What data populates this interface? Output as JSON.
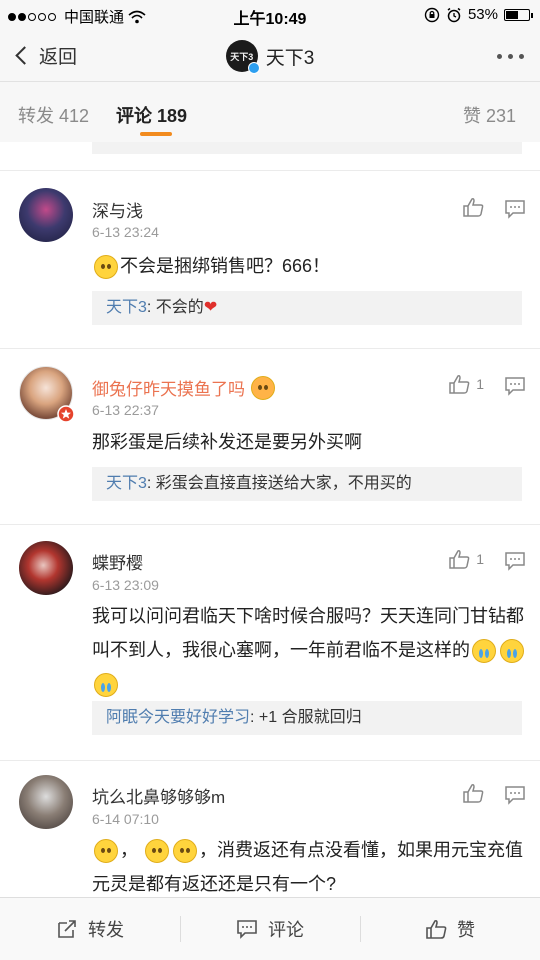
{
  "status_bar": {
    "carrier": "中国联通",
    "time": "上午10:49",
    "battery": "53%",
    "battery_level": 0.53,
    "icons": [
      "signal-dots-icon",
      "wifi-icon",
      "orientation-lock-icon",
      "alarm-icon",
      "battery-icon"
    ]
  },
  "nav": {
    "back_label": "返回",
    "title": "天下3",
    "logo_text": "天下3",
    "icons": [
      "chevron-left-icon",
      "verified-badge-icon",
      "more-icon"
    ]
  },
  "tabs": [
    {
      "label": "转发",
      "count": "412"
    },
    {
      "label": "评论",
      "count": "189"
    },
    {
      "label": "赞",
      "count": "231"
    }
  ],
  "comments": [
    {
      "author": "深与浅",
      "time": "6-13 23:24",
      "text": "不会是捆绑销售吧？666！",
      "likes": "",
      "reply_name": "天下3",
      "reply_text": ": 不会的"
    },
    {
      "author": "御兔仔昨天摸鱼了吗",
      "time": "6-13 22:37",
      "text": "那彩蛋是后续补发还是要另外买啊",
      "likes": "1",
      "reply_name": "天下3",
      "reply_text": ": 彩蛋会直接直接送给大家，不用买的"
    },
    {
      "author": "蝶野樱",
      "time": "6-13 23:09",
      "text": "我可以问问君临天下啥时候合服吗？天天连同门甘钻都叫不到人，我很心塞啊，一年前君临不是这样的",
      "likes": "1",
      "reply_name": "阿眠今天要好好学习",
      "reply_text": ": +1 合服就回归"
    },
    {
      "author": "坑么北鼻够够够m",
      "time": "6-14 07:10",
      "text_a": "，",
      "text_b": "，消费返还有点没看懂，如果用元宝充值元灵是都有返还还是只有一个?",
      "likes": ""
    }
  ],
  "toolbar": {
    "repost": "转发",
    "comment": "评论",
    "like": "赞"
  },
  "colors": {
    "accent": "#f28b1e",
    "link": "#507daf",
    "vip_name": "#eb7350"
  }
}
